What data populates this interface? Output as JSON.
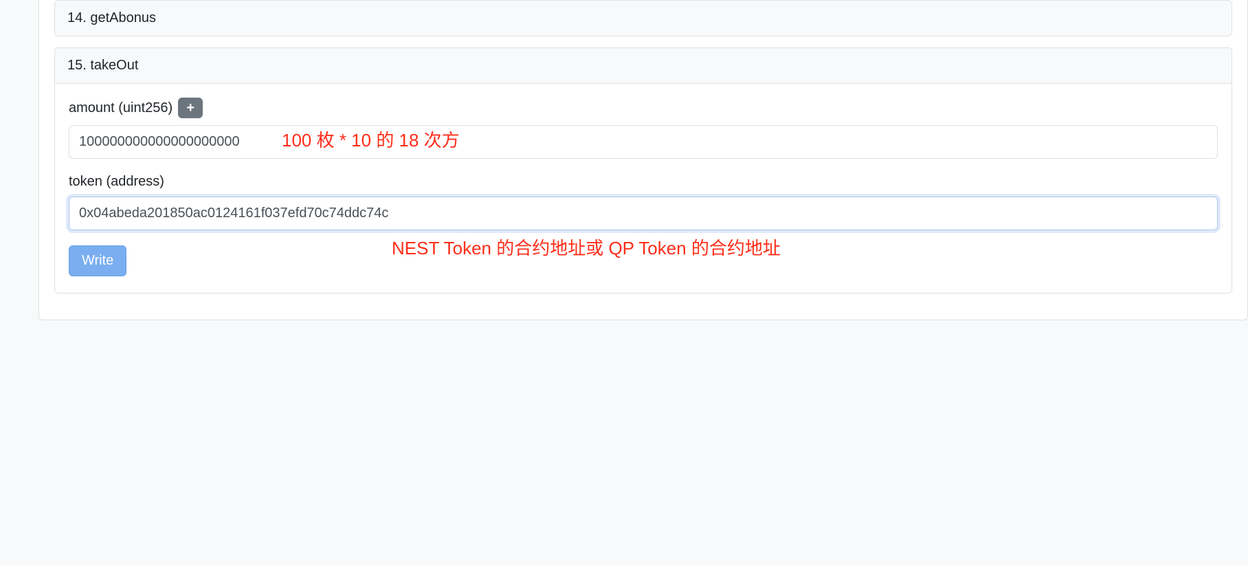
{
  "panels": {
    "p14": {
      "title": "14. getAbonus"
    },
    "p15": {
      "title": "15. takeOut",
      "amount_label": "amount (uint256)",
      "amount_value": "100000000000000000000",
      "token_label": "token (address)",
      "token_value": "0x04abeda201850ac0124161f037efd70c74ddc74c",
      "write_label": "Write"
    }
  },
  "annotations": {
    "amount_note": "100 枚 * 10 的 18 次方",
    "token_note": "NEST Token 的合约地址或 QP Token 的合约地址"
  },
  "icons": {
    "plus": "+"
  }
}
